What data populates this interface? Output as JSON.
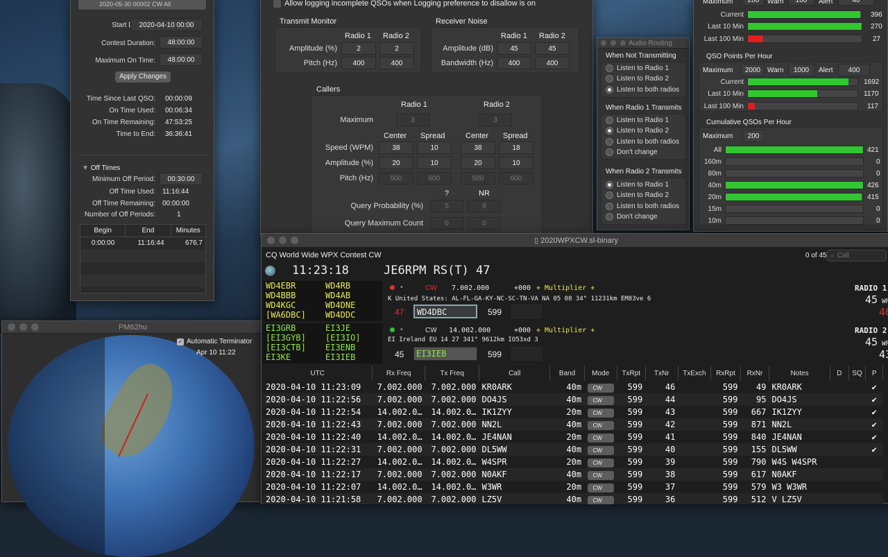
{
  "leftpanel": {
    "top_text": "2020-05-30 00002 CW All",
    "start_date_label": "Start Date:",
    "start_date": "2020-04-10 00:00",
    "duration_label": "Contest Duration:",
    "duration": "48:00:00",
    "max_on_label": "Maximum On Time:",
    "max_on": "48:00:00",
    "apply": "Apply Changes",
    "since_label": "Time Since Last QSO:",
    "since": "00:00:09",
    "on_used_label": "On Time Used:",
    "on_used": "00:06:34",
    "on_rem_label": "On Time Remaining:",
    "on_rem": "47:53:25",
    "to_end_label": "Time to End:",
    "to_end": "36:36:41",
    "off_times": "Off Times",
    "min_off_label": "Minimum Off Period:",
    "min_off": "00:30:00",
    "off_used_label": "Off Time Used:",
    "off_used": "11:16:44",
    "off_rem_label": "Off Time Remaining:",
    "off_rem": "00:00:00",
    "num_off_label": "Number of Off Periods:",
    "num_off": "1",
    "tbl_begin": "Begin",
    "tbl_end": "End",
    "tbl_minutes": "Minutes",
    "row_begin": "0:00:00",
    "row_end": "11:16:44",
    "row_minutes": "676.7"
  },
  "sim": {
    "checkbox_label": "Allow logging incomplete QSOs when Logging preference to disallow is on",
    "tx_monitor": "Transmit Monitor",
    "radio1": "Radio 1",
    "radio2": "Radio 2",
    "amp_pct": "Amplitude (%)",
    "amp_r1": "2",
    "amp_r2": "2",
    "pitch_hz": "Pitch (Hz)",
    "pitch_r1": "400",
    "pitch_r2": "400",
    "rx_noise": "Receiver Noise",
    "amp_db": "Amplitude (dB)",
    "noise_amp_r1": "45",
    "noise_amp_r2": "45",
    "bandwidth": "Bandwidth (Hz)",
    "bw_r1": "400",
    "bw_r2": "400",
    "callers": "Callers",
    "maximum": "Maximum",
    "max_r1": "3",
    "max_r2": "3",
    "center": "Center",
    "spread": "Spread",
    "speed": "Speed (WPM)",
    "speed_vals": [
      "38",
      "10",
      "38",
      "18"
    ],
    "amp_vals": [
      "20",
      "10",
      "20",
      "10"
    ],
    "pitch_vals": [
      "500",
      "600",
      "500",
      "600"
    ],
    "q": "?",
    "nr": "NR",
    "query_prob": "Query Probability (%)",
    "qp_vals": [
      "5",
      "8"
    ],
    "query_max": "Query Maximum Count",
    "qm_vals": [
      "0",
      "0"
    ]
  },
  "audio": {
    "title": "Audio Routing",
    "g1": "When Not Transmitting",
    "g1_opts": [
      "Listen to Radio 1",
      "Listen to Radio 2",
      "Listen to both radios"
    ],
    "g2": "When Radio 1 Transmits",
    "g2_opts": [
      "Listen to Radio 1",
      "Listen to Radio 2",
      "Listen to both radios",
      "Don't change"
    ],
    "g3": "When Radio 2 Transmits",
    "g3_opts": [
      "Listen to Radio 1",
      "Listen to Radio 2",
      "Listen to both radios",
      "Don't change"
    ]
  },
  "stats": {
    "maximum": "Maximum",
    "warn": "Warn",
    "alert": "Alert",
    "top_max": "200",
    "top_warn": "100",
    "top_alert": "40",
    "current": "Current",
    "last10": "Last 10 Min",
    "last100": "Last 100 Min",
    "r_current": 396,
    "r_last10": 270,
    "r_last100": 27,
    "qso_points_title": "QSO Points Per Hour",
    "qp_max": "2000",
    "qp_warn": "1000",
    "qp_alert": "400",
    "qp_current": 1692,
    "qp_last10": 1170,
    "qp_last100": 117,
    "cum_title": "Cumulative QSOs Per Hour",
    "cum_max": "200",
    "bands": [
      {
        "name": "All",
        "value": 421
      },
      {
        "name": "160m",
        "value": 0
      },
      {
        "name": "80m",
        "value": 0
      },
      {
        "name": "40m",
        "value": 426
      },
      {
        "name": "20m",
        "value": 415
      },
      {
        "name": "15m",
        "value": 0
      },
      {
        "name": "10m",
        "value": 0
      }
    ]
  },
  "map": {
    "title": "PM62hu",
    "auto_term": "Automatic Terminator",
    "date": "Apr 10 11:22"
  },
  "main": {
    "title": "2020WPXCW.sl-binary",
    "contest": "CQ World Wide WPX Contest CW",
    "count": "0 of 45",
    "search_placeholder": "Call",
    "time": "11:23:18",
    "exchange": "JE6RPM RS(T) 47",
    "r1_calls": [
      [
        "WD4EBR",
        "WD4RB"
      ],
      [
        "WD4BBB",
        "WD4AB"
      ],
      [
        "WD4KGC",
        "WD4DNE"
      ],
      [
        "[WA6DBC]",
        "WD4DDC"
      ]
    ],
    "r1_mode": "CW",
    "r1_freq": "7.002.000",
    "r1_offset": "+000",
    "r1_mult": "+ Multiplier +",
    "r1_info": "K United States: AL-FL-GA-KY-NC-SC-TN-VA NA 05 08 34° 11231km EM83ve 6",
    "r1_nr": "47",
    "r1_call": "WD4DBC",
    "r1_rst": "599",
    "r1_label": "RADIO 1",
    "r1_wpm": "45",
    "wpm": "WPM",
    "r1_rx": "46",
    "r2_calls": [
      [
        "EI3GRB",
        "EI3JE"
      ],
      [
        "[EI3GYB]",
        "[EI3IO]"
      ],
      [
        "[EI3CTB]",
        "EI3ENB"
      ],
      [
        "EI3KE",
        "EI3IEB"
      ]
    ],
    "r2_mode": "CW",
    "r2_freq": "14.002.000",
    "r2_offset": "+000",
    "r2_mult": "+ Multiplier +",
    "r2_info": "EI Ireland EU 14 27 341° 9612km IO53xd 3",
    "r2_nr": "45",
    "r2_call": "EI3IEB",
    "r2_rst": "599",
    "r2_label": "RADIO 2",
    "r2_wpm": "45",
    "r2_rx": "43",
    "cols": [
      "UTC",
      "Rx Freq",
      "Tx Freq",
      "Call",
      "Band",
      "Mode",
      "TxRpt",
      "TxNr",
      "TxExch",
      "RxRpt",
      "RxNr",
      "Notes",
      "D",
      "SQ",
      "P"
    ],
    "rows": [
      [
        "2020-04-10 11:23:09",
        "7.002.000",
        "7.002.000",
        "KR0ARK",
        "40m",
        "CW",
        "599",
        "46",
        "",
        "599",
        "49",
        "KR0ARK",
        "✔"
      ],
      [
        "2020-04-10 11:22:56",
        "7.002.000",
        "7.002.000",
        "DO4JS",
        "40m",
        "CW",
        "599",
        "44",
        "",
        "599",
        "95",
        "DO4JS",
        "✔"
      ],
      [
        "2020-04-10 11:22:54",
        "14.002.0…",
        "14.002.0…",
        "IK1ZYY",
        "20m",
        "CW",
        "599",
        "43",
        "",
        "599",
        "667",
        "IK1ZYY",
        "✔"
      ],
      [
        "2020-04-10 11:22:43",
        "7.002.000",
        "7.002.000",
        "NN2L",
        "40m",
        "CW",
        "599",
        "42",
        "",
        "599",
        "871",
        "NN2L",
        "✔"
      ],
      [
        "2020-04-10 11:22:40",
        "14.002.0…",
        "14.002.0…",
        "JE4NAN",
        "20m",
        "CW",
        "599",
        "41",
        "",
        "599",
        "840",
        "JE4NAN",
        "✔"
      ],
      [
        "2020-04-10 11:22:31",
        "7.002.000",
        "7.002.000",
        "DL5WW",
        "40m",
        "CW",
        "599",
        "40",
        "",
        "599",
        "155",
        "DL5WW",
        "✔"
      ],
      [
        "2020-04-10 11:22:27",
        "14.002.0…",
        "14.002.0…",
        "W4SPR",
        "20m",
        "CW",
        "599",
        "39",
        "",
        "599",
        "790",
        "W4S W4SPR",
        ""
      ],
      [
        "2020-04-10 11:22:17",
        "7.002.000",
        "7.002.000",
        "N0AKF",
        "40m",
        "CW",
        "599",
        "38",
        "",
        "599",
        "617",
        "N0AKF",
        ""
      ],
      [
        "2020-04-10 11:22:07",
        "14.002.0…",
        "14.002.0…",
        "W3WR",
        "20m",
        "CW",
        "599",
        "37",
        "",
        "599",
        "579",
        "W3 W3WR",
        ""
      ],
      [
        "2020-04-10 11:21:58",
        "7.002.000",
        "7.002.000",
        "LZ5V",
        "40m",
        "CW",
        "599",
        "36",
        "",
        "599",
        "512",
        "V LZ5V",
        ""
      ]
    ]
  }
}
